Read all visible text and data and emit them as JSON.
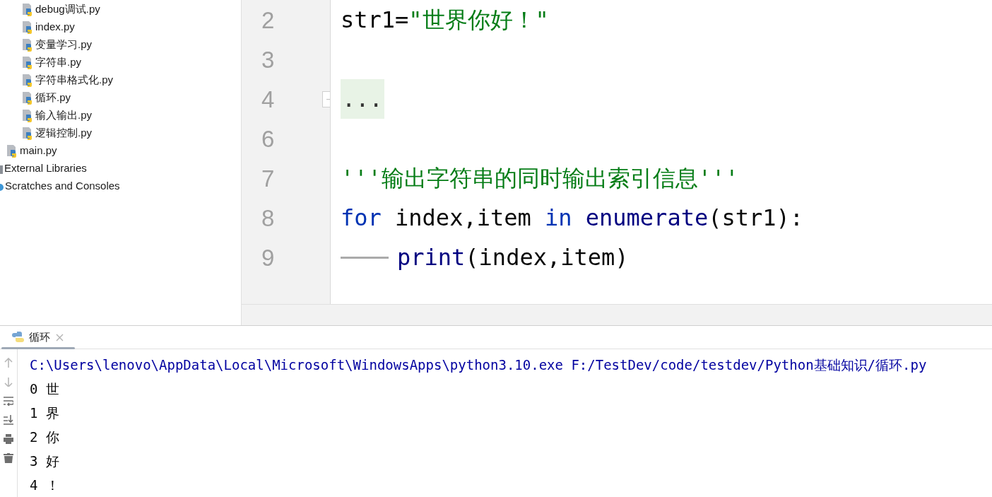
{
  "project_tree": [
    {
      "children": [
        {
          "children": [
            {
              "label": "debug调试.py",
              "kind": "python"
            },
            {
              "label": "index.py",
              "kind": "python"
            },
            {
              "label": "变量学习.py",
              "kind": "python"
            },
            {
              "label": "字符串.py",
              "kind": "python"
            },
            {
              "label": "字符串格式化.py",
              "kind": "python"
            },
            {
              "label": "循环.py",
              "kind": "python"
            },
            {
              "label": "输入输出.py",
              "kind": "python"
            },
            {
              "label": "逻辑控制.py",
              "kind": "python"
            }
          ]
        },
        {
          "label": "main.py",
          "kind": "python"
        }
      ]
    },
    {
      "label": "External Libraries",
      "kind": "library"
    },
    {
      "label": "Scratches and Consoles",
      "kind": "scratches"
    }
  ],
  "editor": {
    "lines": [
      {
        "number": "2",
        "fold": false,
        "indent": false,
        "tokens": [
          {
            "text": "str1=",
            "kind": "plain"
          },
          {
            "text": "\"世界你好！\"",
            "kind": "string"
          }
        ]
      },
      {
        "number": "3",
        "fold": false,
        "indent": false
      },
      {
        "number": "4",
        "fold": true,
        "indent": false,
        "tokens": [
          {
            "text": "...",
            "kind": "folded"
          }
        ]
      },
      {
        "number": "6",
        "fold": false,
        "indent": false
      },
      {
        "number": "7",
        "fold": false,
        "indent": false,
        "tokens": [
          {
            "text": "'''输出字符串的同时输出索引信息'''",
            "kind": "string"
          }
        ]
      },
      {
        "number": "8",
        "fold": false,
        "indent": false,
        "tokens": [
          {
            "text": "for",
            "kind": "keyword"
          },
          {
            "text": " index,item ",
            "kind": "plain"
          },
          {
            "text": "in",
            "kind": "keyword"
          },
          {
            "text": " enumerate",
            "kind": "builtin"
          },
          {
            "text": "(str1):",
            "kind": "plain"
          }
        ]
      },
      {
        "number": "9",
        "fold": false,
        "indent": true,
        "tokens": [
          {
            "text": "print",
            "kind": "builtin"
          },
          {
            "text": "(index,item)",
            "kind": "plain"
          }
        ]
      }
    ]
  },
  "run_panel": {
    "tab": {
      "label": "循环",
      "selected": true
    },
    "output": [
      {
        "text": "C:\\Users\\lenovo\\AppData\\Local\\Microsoft\\WindowsApps\\python3.10.exe F:/TestDev/code/testdev/Python基础知识/循环.py",
        "kind": "command"
      },
      {
        "text": "0 世",
        "kind": "stdout"
      },
      {
        "text": "1 界",
        "kind": "stdout"
      },
      {
        "text": "2 你",
        "kind": "stdout"
      },
      {
        "text": "3 好",
        "kind": "stdout"
      },
      {
        "text": "4 ！",
        "kind": "stdout"
      }
    ]
  }
}
